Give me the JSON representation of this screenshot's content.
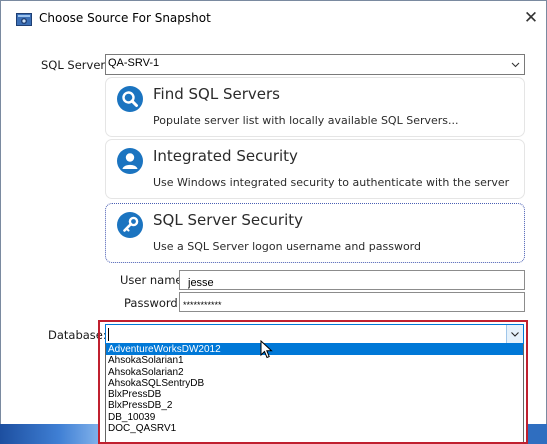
{
  "window": {
    "title": "Choose Source For Snapshot",
    "icon": "snapshot-app-icon",
    "close_icon": "close-icon"
  },
  "server": {
    "label": "SQL Server:",
    "value": "QA-SRV-1"
  },
  "options": [
    {
      "title": "Find SQL Servers",
      "description": "Populate server list with locally available SQL Servers...",
      "icon": "search-icon",
      "selected": false
    },
    {
      "title": "Integrated Security",
      "description": "Use Windows integrated security to authenticate with the server",
      "icon": "user-icon",
      "selected": false
    },
    {
      "title": "SQL Server Security",
      "description": "Use a SQL Server logon username and password",
      "icon": "key-icon",
      "selected": true
    }
  ],
  "credentials": {
    "username_label": "User name:",
    "username_value": "jesse",
    "password_label": "Password:",
    "password_value": "***********"
  },
  "database": {
    "label": "Database:",
    "value": "",
    "items": [
      "AdventureWorksDW2012",
      "AhsokaSolarian1",
      "AhsokaSolarian2",
      "AhsokaSQLSentryDB",
      "BlxPressDB",
      "BlxPressDB_2",
      "DB_10039",
      "DOC_QASRV1"
    ],
    "highlighted_index": 0
  },
  "colors": {
    "accent": "#0078d7",
    "card_icon": "#1b74c0",
    "highlight_border": "#c0202f"
  }
}
